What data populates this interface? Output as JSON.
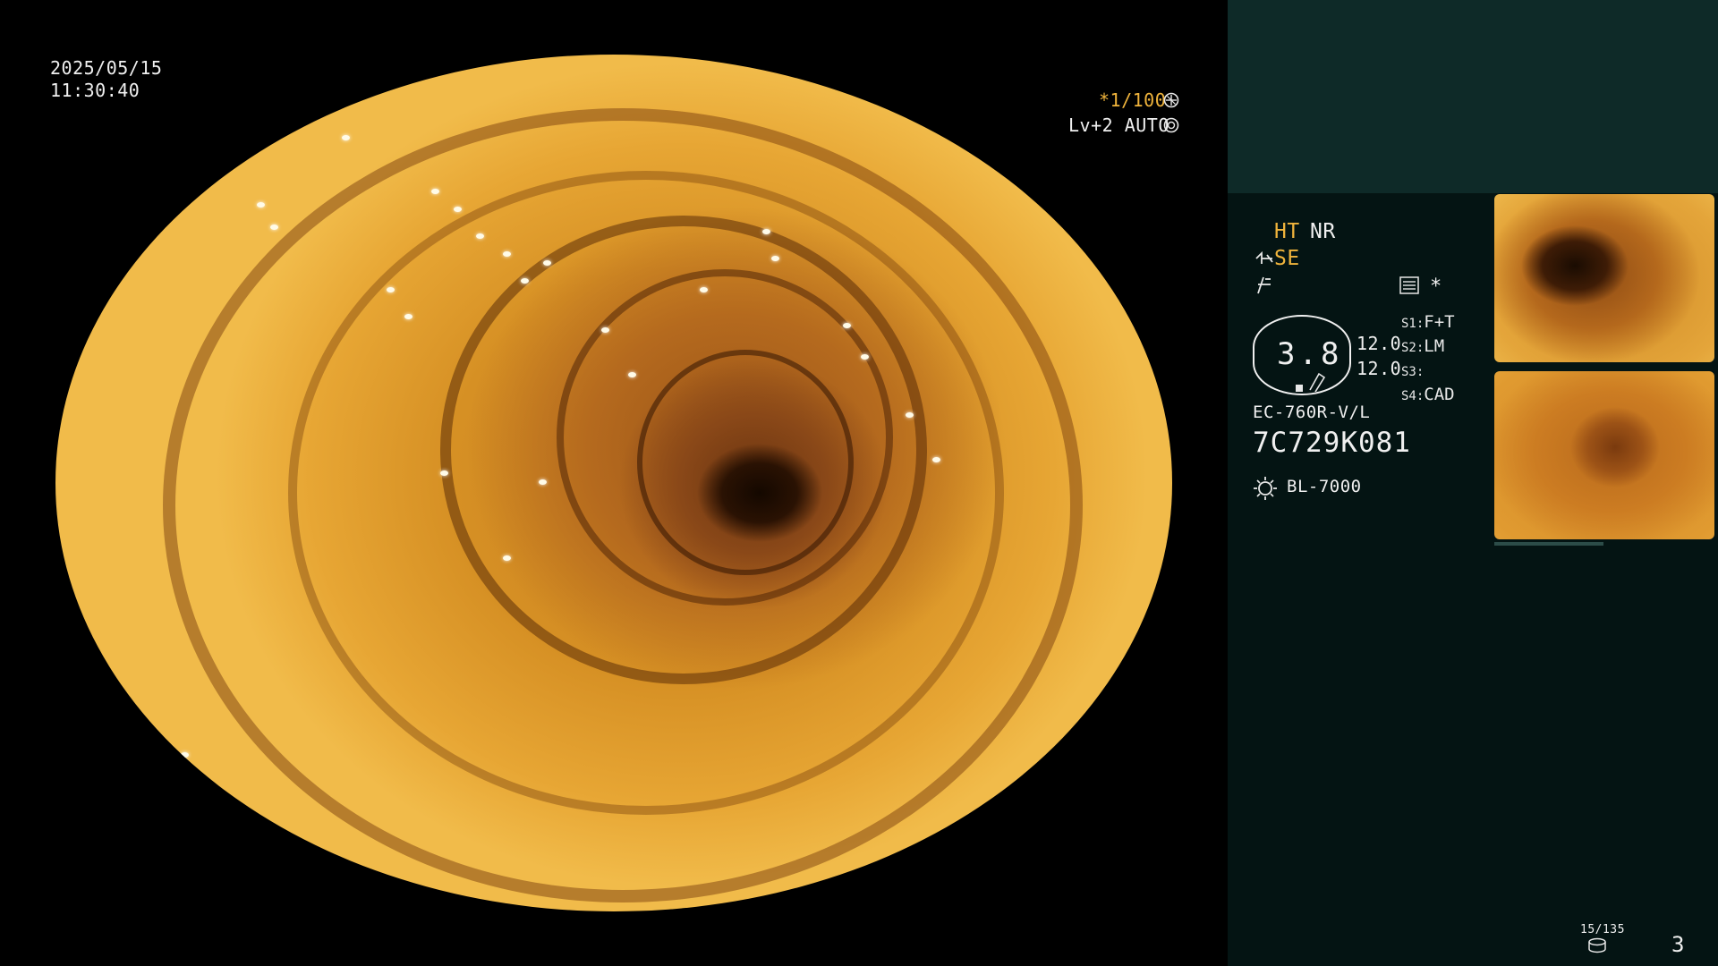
{
  "overlay": {
    "date": "2025/05/15",
    "time": "11:30:40",
    "shutter": "*1/100",
    "level": "Lv+2 AUTO"
  },
  "panel": {
    "ht": "HT",
    "nr": "NR",
    "se": "SE",
    "zoom_value": "3.8",
    "values": [
      "12.0",
      "12.0"
    ],
    "switch_labels": [
      {
        "key": "S1:",
        "value": "F+T"
      },
      {
        "key": "S2:",
        "value": "LM"
      },
      {
        "key": "S3:",
        "value": ""
      },
      {
        "key": "S4:",
        "value": "CAD"
      }
    ],
    "asterisk": "*",
    "scope_model": "EC-760R-V/L",
    "scope_serial": "7C729K081",
    "light_source": "BL-7000",
    "capture_count": "15/135",
    "page_number": "3"
  },
  "colors": {
    "accent_yellow": "#f0b43c",
    "panel_bg": "#041413",
    "panel_top_bg": "#0e2a28"
  }
}
